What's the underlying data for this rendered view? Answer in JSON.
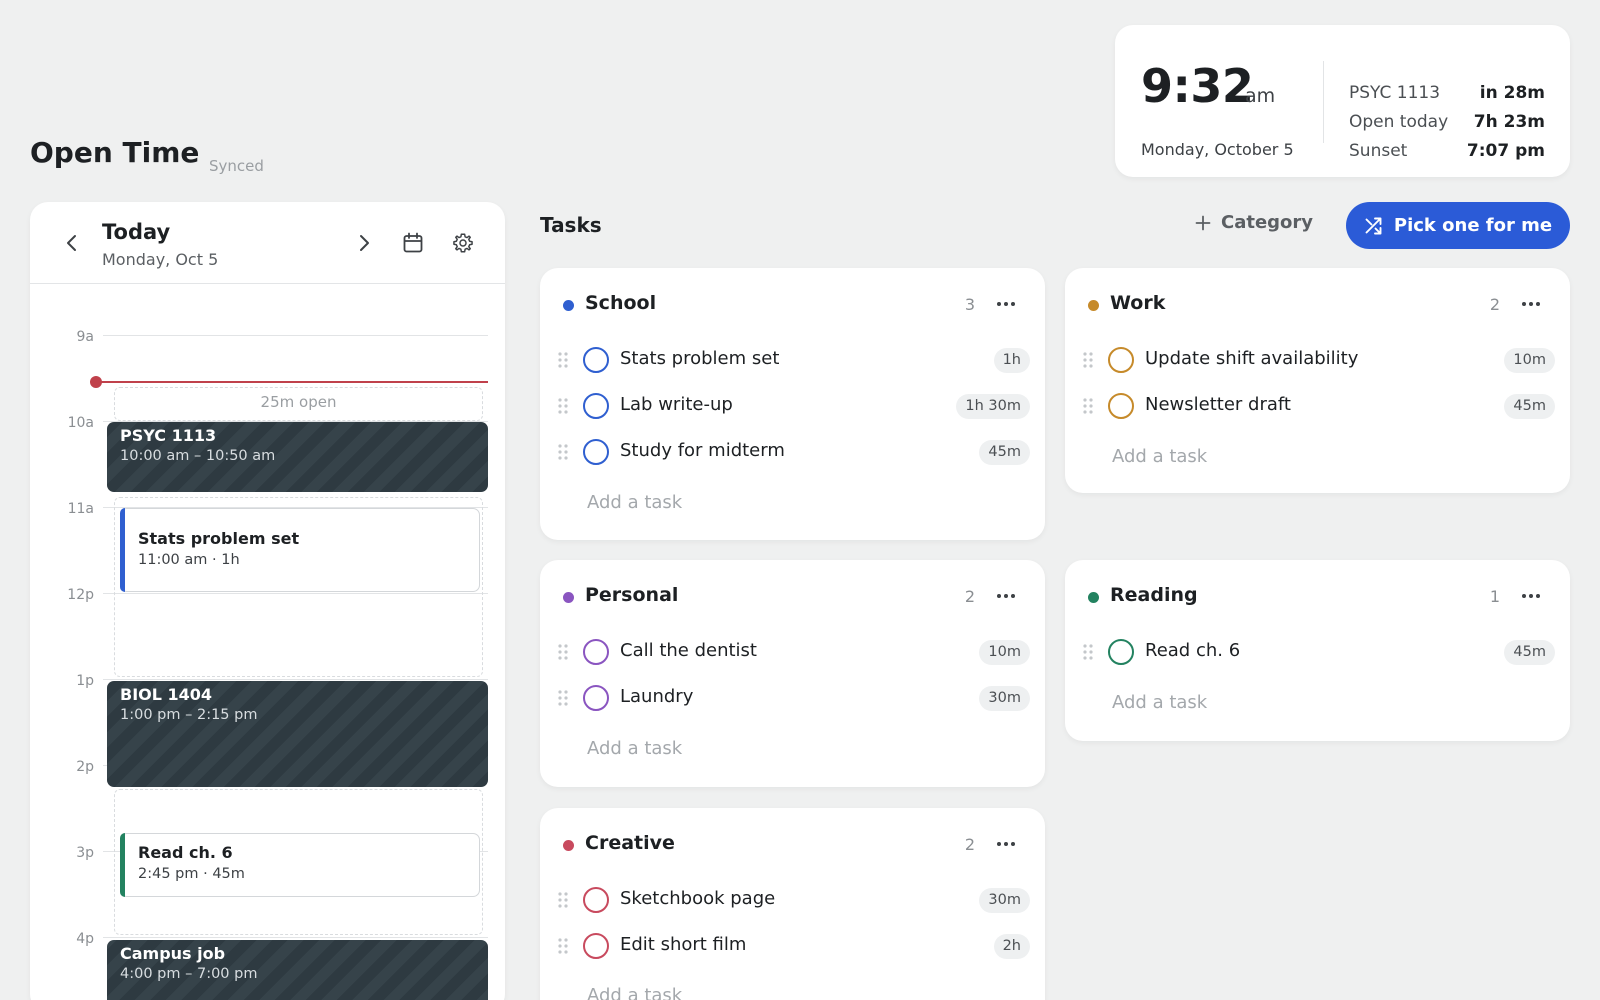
{
  "app": {
    "title": "Open Time",
    "sync_status": "Synced"
  },
  "clock": {
    "time": "9:32",
    "ampm": "am",
    "date": "Monday, October 5",
    "rows": [
      {
        "label": "PSYC 1113",
        "value": "in 28m"
      },
      {
        "label": "Open today",
        "value": "7h 23m"
      },
      {
        "label": "Sunset",
        "value": "7:07 pm"
      }
    ]
  },
  "calendar": {
    "title": "Today",
    "date": "Monday, Oct 5",
    "hours": [
      "9a",
      "10a",
      "11a",
      "12p",
      "1p",
      "2p",
      "3p",
      "4p"
    ],
    "open_slot_label": "25m open",
    "busy": [
      {
        "title": "PSYC 1113",
        "time": "10:00 am – 10:50 am"
      },
      {
        "title": "BIOL 1404",
        "time": "1:00 pm – 2:15 pm"
      },
      {
        "title": "Campus job",
        "time": "4:00 pm – 7:00 pm"
      }
    ],
    "scheduled": [
      {
        "title": "Stats problem set",
        "meta": "11:00 am · 1h"
      },
      {
        "title": "Read ch. 6",
        "meta": "2:45 pm · 45m"
      }
    ]
  },
  "tasks": {
    "title": "Tasks",
    "add_category_label": "Category",
    "pick_label": "Pick one for me",
    "add_task_label": "Add a task"
  },
  "categories": [
    {
      "name": "School",
      "count": "3",
      "color": "#2f5fd0",
      "tasks": [
        {
          "name": "Stats problem set",
          "duration": "1h"
        },
        {
          "name": "Lab write-up",
          "duration": "1h 30m"
        },
        {
          "name": "Study for midterm",
          "duration": "45m"
        }
      ]
    },
    {
      "name": "Work",
      "count": "2",
      "color": "#c68a2a",
      "tasks": [
        {
          "name": "Update shift availability",
          "duration": "10m"
        },
        {
          "name": "Newsletter draft",
          "duration": "45m"
        }
      ]
    },
    {
      "name": "Personal",
      "count": "2",
      "color": "#8a55c0",
      "tasks": [
        {
          "name": "Call the dentist",
          "duration": "10m"
        },
        {
          "name": "Laundry",
          "duration": "30m"
        }
      ]
    },
    {
      "name": "Reading",
      "count": "1",
      "color": "#238260",
      "tasks": [
        {
          "name": "Read ch. 6",
          "duration": "45m"
        }
      ]
    },
    {
      "name": "Creative",
      "count": "2",
      "color": "#c84a5e",
      "tasks": [
        {
          "name": "Sketchbook page",
          "duration": "30m"
        },
        {
          "name": "Edit short film",
          "duration": "2h"
        }
      ]
    }
  ]
}
